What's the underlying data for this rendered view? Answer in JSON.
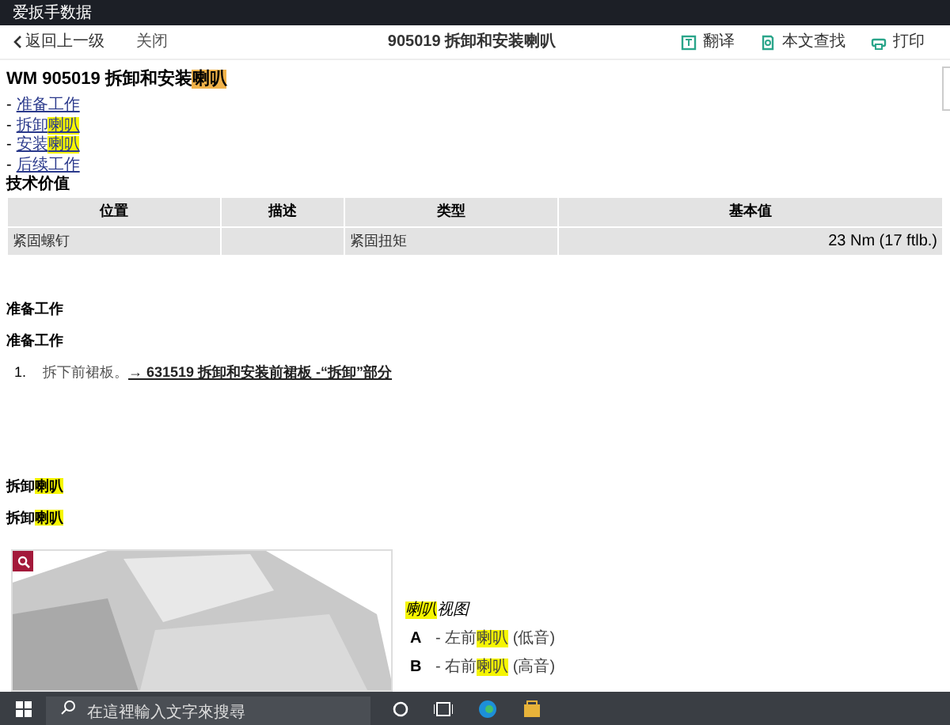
{
  "window": {
    "title": "爱扳手数据"
  },
  "toolbar": {
    "back": "返回上一级",
    "close": "关闭",
    "title": "905019 拆卸和安装喇叭",
    "actions": [
      {
        "kind": "translate",
        "label": "翻译"
      },
      {
        "kind": "find",
        "label": "本文查找"
      },
      {
        "kind": "print",
        "label": "打印"
      }
    ]
  },
  "heading": [
    {
      "text": "WM 905019 拆卸和安装"
    },
    {
      "text": "喇叭",
      "highlighted": true
    }
  ],
  "toc": [
    {
      "bullet": "-",
      "parts": [
        {
          "text": "准备工作"
        }
      ]
    },
    {
      "bullet": "-",
      "parts": [
        {
          "text": "拆卸"
        },
        {
          "text": "喇叭",
          "highlighted": true
        }
      ]
    },
    {
      "bullet": "-",
      "parts": [
        {
          "text": "安装"
        },
        {
          "text": "喇叭",
          "highlighted": true
        }
      ]
    },
    {
      "bullet": "-",
      "parts": [
        {
          "text": "后续工作"
        }
      ]
    }
  ],
  "tech_heading": "技术价值",
  "table": {
    "columns": [
      "位置",
      "描述",
      "类型",
      "基本值"
    ],
    "rows": [
      [
        "紧固螺钉",
        "",
        "紧固扭矩",
        "23 Nm (17 ftlb.)"
      ]
    ]
  },
  "sections": [
    {
      "kind": "heading",
      "parts": [
        {
          "text": "准备工作"
        }
      ]
    },
    {
      "kind": "subheading",
      "parts": [
        {
          "text": "准备工作"
        }
      ]
    },
    {
      "kind": "step",
      "number": "1.",
      "text": "拆下前裙板。",
      "link": "→ 631519 拆卸和安装前裙板 -“拆卸”部分"
    },
    {
      "kind": "heading",
      "parts": [
        {
          "text": "拆卸"
        },
        {
          "text": "喇叭",
          "highlighted": true
        }
      ]
    },
    {
      "kind": "subheading",
      "parts": [
        {
          "text": "拆卸"
        },
        {
          "text": "喇叭",
          "highlighted": true
        }
      ]
    }
  ],
  "figure": {
    "caption": [
      {
        "text": "喇叭",
        "highlighted": true
      },
      {
        "text": "视图"
      }
    ],
    "legend": [
      {
        "key": "A",
        "parts": [
          {
            "text": "- 左前"
          },
          {
            "text": "喇叭",
            "highlighted": true
          },
          {
            "text": " (低音)"
          }
        ]
      },
      {
        "key": "B",
        "parts": [
          {
            "text": "- 右前"
          },
          {
            "text": "喇叭",
            "highlighted": true
          },
          {
            "text": " (高音)"
          }
        ]
      }
    ]
  },
  "taskbar": {
    "search_placeholder": "在這裡輸入文字來搜尋"
  }
}
